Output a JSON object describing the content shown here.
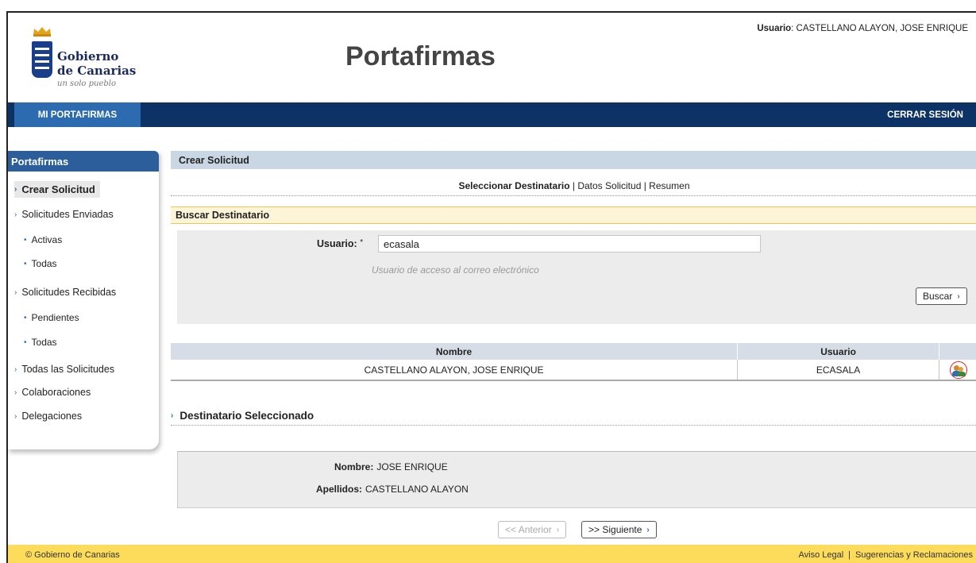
{
  "header": {
    "logo_line1": "Gobierno",
    "logo_line2": "de Canarias",
    "logo_tagline": "un solo pueblo",
    "app_title": "Portafirmas",
    "user_label": "Usuario",
    "user_name": ": CASTELLANO ALAYON, JOSE ENRIQUE"
  },
  "nav": {
    "active_tab": "MI PORTAFIRMAS",
    "logout": "CERRAR SESIÓN"
  },
  "sidebar": {
    "title": "Portafirmas",
    "items": [
      {
        "label": "Crear Solicitud",
        "active": true
      },
      {
        "label": "Solicitudes Enviadas"
      },
      {
        "label": "Activas",
        "sub": true
      },
      {
        "label": "Todas",
        "sub": true
      },
      {
        "label": "Solicitudes Recibidas"
      },
      {
        "label": "Pendientes",
        "sub": true
      },
      {
        "label": "Todas",
        "sub": true
      },
      {
        "label": "Todas las Solicitudes"
      },
      {
        "label": "Colaboraciones"
      },
      {
        "label": "Delegaciones"
      }
    ]
  },
  "main": {
    "section_title": "Crear Solicitud",
    "steps": {
      "current": "Seleccionar Destinatario",
      "sep1": " | ",
      "step2": "Datos Solicitud",
      "sep2": " | ",
      "step3": "Resumen"
    },
    "search": {
      "title": "Buscar Destinatario",
      "field_label": "Usuario:",
      "required_mark": "*",
      "value": "ecasala",
      "hint": "Usuario de acceso al correo electrónico",
      "button": "Buscar"
    },
    "results": {
      "columns": [
        "Nombre",
        "Usuario",
        ""
      ],
      "rows": [
        {
          "nombre": "CASTELLANO ALAYON, JOSE ENRIQUE",
          "usuario": "ECASALA"
        }
      ]
    },
    "selected": {
      "title": "Destinatario Seleccionado",
      "nombre_label": "Nombre:",
      "nombre_value": "JOSE ENRIQUE",
      "apellidos_label": "Apellidos:",
      "apellidos_value": "CASTELLANO ALAYON"
    },
    "buttons": {
      "prev": "<< Anterior",
      "next": ">> Siguiente"
    }
  },
  "footer": {
    "copyright": "© Gobierno de Canarias",
    "legal": "Aviso Legal",
    "sep": "|",
    "feedback": "Sugerencias y Reclamaciones"
  },
  "colors": {
    "navbar": "#0d3366",
    "nav_active": "#2c6bb0",
    "footer": "#fddc5c",
    "section_bar": "#c9d6e3",
    "search_bar": "#fef4d8"
  }
}
